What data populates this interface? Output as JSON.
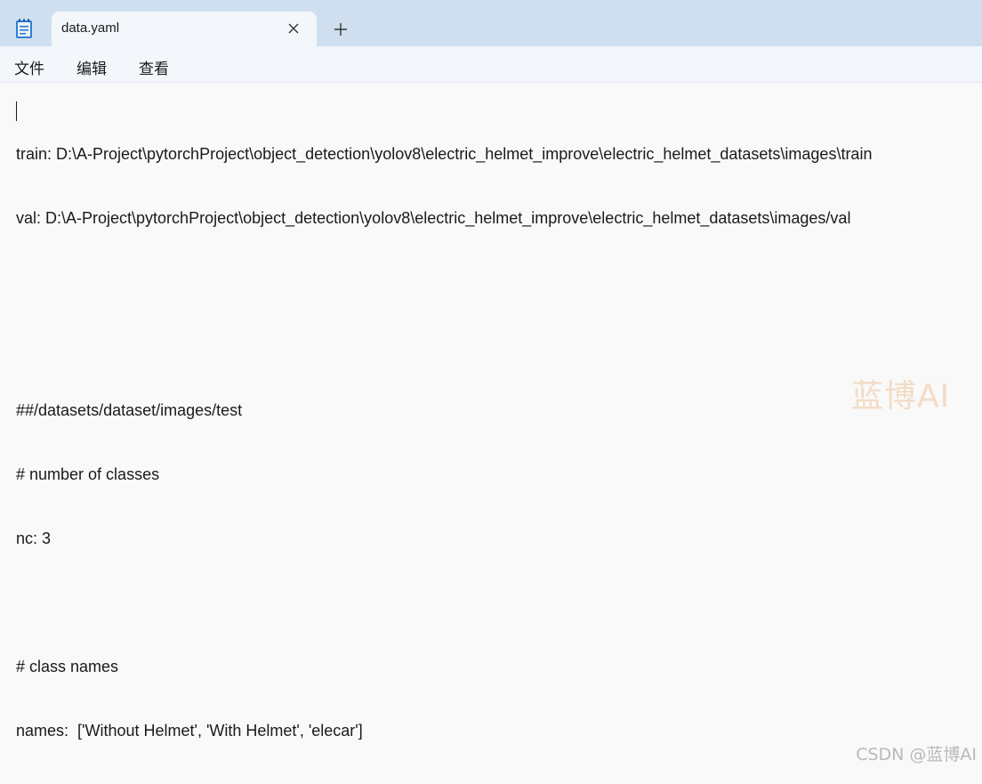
{
  "tab": {
    "title": "data.yaml",
    "close_icon": "close-icon",
    "new_tab_icon": "plus-icon"
  },
  "app_icon": "notepad-icon",
  "menu": {
    "file": "文件",
    "edit": "编辑",
    "view": "查看"
  },
  "editor": {
    "lines": [
      "train: D:\\A-Project\\pytorchProject\\object_detection\\yolov8\\electric_helmet_improve\\electric_helmet_datasets\\images\\train",
      "val: D:\\A-Project\\pytorchProject\\object_detection\\yolov8\\electric_helmet_improve\\electric_helmet_datasets\\images/val",
      "",
      "",
      "##/datasets/dataset/images/test",
      "# number of classes",
      "nc: 3",
      "",
      "# class names",
      "names:  ['Without Helmet', 'With Helmet', 'elecar']"
    ]
  },
  "watermark": {
    "center": "蓝博AI",
    "corner": "CSDN @蓝博AI"
  },
  "colors": {
    "titlebar": "#cfdfef",
    "tab": "#f3f6fa",
    "editor_bg": "#f9f9f9",
    "text": "#1a1a1a"
  }
}
